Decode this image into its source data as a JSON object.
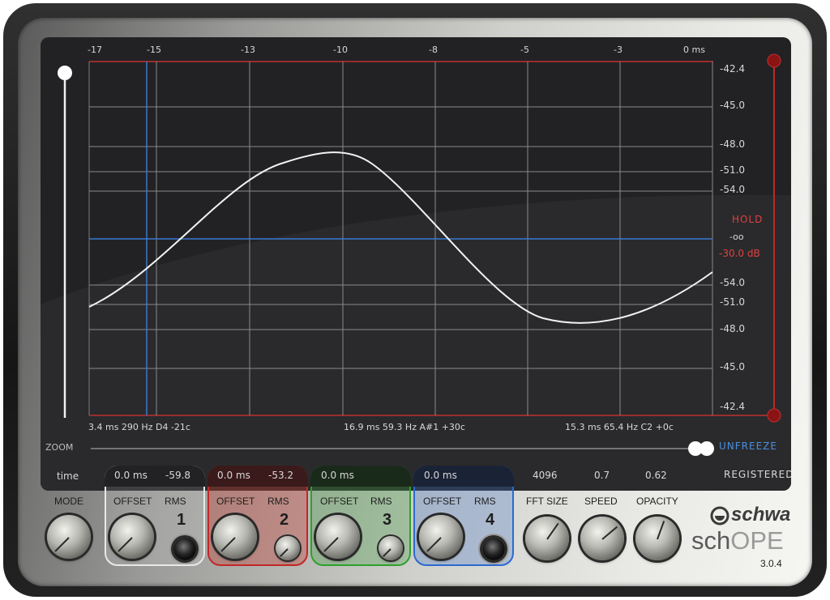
{
  "display": {
    "time_ticks": [
      "-17",
      "-15",
      "-13",
      "-10",
      "-8",
      "-5",
      "-3",
      "0 ms"
    ],
    "db_ticks": [
      "-42.4",
      "-45.0",
      "-48.0",
      "-51.0",
      "-54.0",
      "-54.0",
      "-51.0",
      "-48.0",
      "-45.0",
      "-42.4"
    ],
    "hold_label": "HOLD",
    "hold_value": "-oo",
    "db_readout": "-30.0 dB",
    "cursor_left": "3.4 ms 290 Hz D4 -21c",
    "cursor_center": "16.9 ms 59.3 Hz A#1 +30c",
    "cursor_right": "15.3 ms 65.4 Hz C2 +0c",
    "zoom_label": "ZOOM",
    "unfreeze_label": "UNFREEZE"
  },
  "readouts": {
    "mode_value": "time",
    "ch1_offset": "0.0 ms",
    "ch1_rms": "-59.8",
    "ch2_offset": "0.0 ms",
    "ch2_rms": "-53.2",
    "ch3_offset": "0.0 ms",
    "ch4_offset": "0.0 ms",
    "fft_value": "4096",
    "speed_value": "0.7",
    "opacity_value": "0.62",
    "registered": "REGISTERED"
  },
  "controls": {
    "mode": "MODE",
    "offset": "OFFSET",
    "rms": "RMS",
    "ch1": "1",
    "ch2": "2",
    "ch3": "3",
    "ch4": "4",
    "fft_size": "FFT SIZE",
    "speed": "SPEED",
    "opacity": "OPACITY"
  },
  "brand": {
    "company": "schwa",
    "product_a": "sch",
    "product_b": "OPE",
    "version": "3.0.4"
  },
  "colors": {
    "ch1": "#e8e8e8",
    "ch2": "#d03030",
    "ch3": "#2ea02e",
    "ch4": "#2a6ad0",
    "hold": "#e04040",
    "unfreeze": "#4a90e0",
    "screen_bg": "#222224"
  }
}
